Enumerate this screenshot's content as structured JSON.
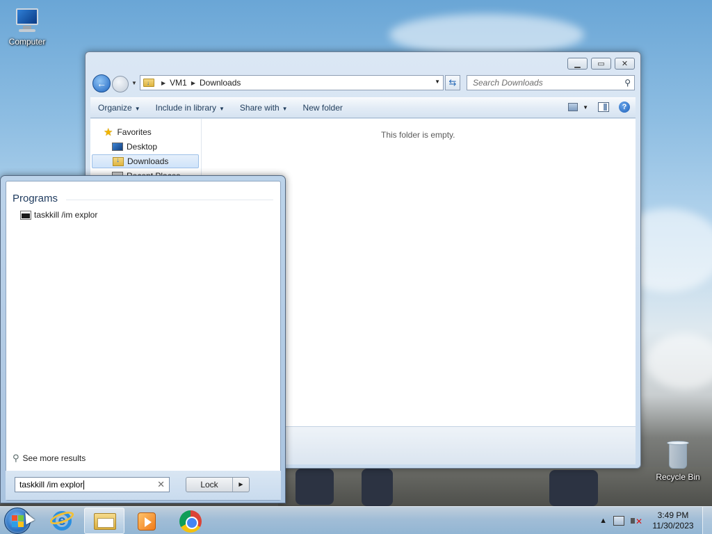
{
  "desktop": {
    "icons": [
      {
        "label": "Computer",
        "icon": "computer-icon"
      },
      {
        "label": "Recycle Bin",
        "icon": "recycle-bin-icon"
      }
    ]
  },
  "explorer": {
    "breadcrumb": [
      "VM1",
      "Downloads"
    ],
    "search_placeholder": "Search Downloads",
    "toolbar": {
      "organize": "Organize",
      "include_in_library": "Include in library",
      "share_with": "Share with",
      "new_folder": "New folder"
    },
    "nav": {
      "favorites": "Favorites",
      "items": [
        "Desktop",
        "Downloads",
        "Recent Places"
      ],
      "selected": "Downloads"
    },
    "empty_message": "This folder is empty."
  },
  "start_menu": {
    "section_heading": "Programs",
    "results": [
      "taskkill /im explor"
    ],
    "see_more": "See more results",
    "search_value": "taskkill /im explor",
    "power_button": "Lock"
  },
  "taskbar": {
    "pinned": [
      "internet-explorer-icon",
      "windows-explorer-icon",
      "windows-media-player-icon",
      "chrome-icon"
    ],
    "active": "windows-explorer-icon",
    "clock_time": "3:49 PM",
    "clock_date": "11/30/2023"
  }
}
